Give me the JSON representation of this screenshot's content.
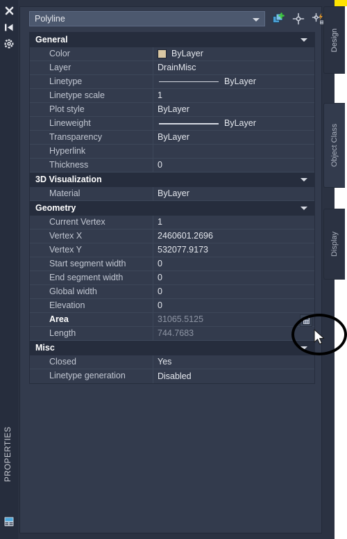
{
  "palette": {
    "title": "PROPERTIES",
    "gutter_icons": [
      {
        "name": "close-icon",
        "label": "Close"
      },
      {
        "name": "auto-hide-icon",
        "label": "Auto-hide"
      },
      {
        "name": "panel-settings-icon",
        "label": "Properties menu"
      }
    ],
    "title_icon": "properties-icon"
  },
  "header": {
    "combo_value": "Polyline",
    "combo_arrow": "chevron-down-icon",
    "tools": [
      {
        "name": "toggle-pickadd-button",
        "icon": "select-objects-plus-icon",
        "label": "Toggle value of PICKADD Sysvar"
      },
      {
        "name": "select-objects-button",
        "icon": "crosshair-icon",
        "label": "Select Objects"
      },
      {
        "name": "quick-select-button",
        "icon": "quick-select-icon",
        "label": "Quick Select"
      }
    ]
  },
  "tabs": [
    {
      "name": "tab-design",
      "label": "Design",
      "active": false
    },
    {
      "name": "tab-object-class",
      "label": "Object Class",
      "active": true
    },
    {
      "name": "tab-display",
      "label": "Display",
      "active": false
    }
  ],
  "sections": [
    {
      "name": "general",
      "title": "General",
      "collapse_icon": "chevron-down-icon",
      "rows": [
        {
          "label": "Color",
          "value": "ByLayer",
          "kind": "color",
          "readonly": false,
          "selected": false
        },
        {
          "label": "Layer",
          "value": "DrainMisc",
          "kind": "text",
          "readonly": false,
          "selected": false
        },
        {
          "label": "Linetype",
          "value": "ByLayer",
          "kind": "linetype",
          "readonly": false,
          "selected": false
        },
        {
          "label": "Linetype scale",
          "value": "1",
          "kind": "text",
          "readonly": false,
          "selected": false
        },
        {
          "label": "Plot style",
          "value": "ByLayer",
          "kind": "text",
          "readonly": false,
          "selected": false
        },
        {
          "label": "Lineweight",
          "value": "ByLayer",
          "kind": "lineweight",
          "readonly": false,
          "selected": false
        },
        {
          "label": "Transparency",
          "value": "ByLayer",
          "kind": "text",
          "readonly": false,
          "selected": false
        },
        {
          "label": "Hyperlink",
          "value": "",
          "kind": "text",
          "readonly": false,
          "selected": false
        },
        {
          "label": "Thickness",
          "value": "0",
          "kind": "text",
          "readonly": false,
          "selected": false
        }
      ]
    },
    {
      "name": "3d-visualization",
      "title": "3D Visualization",
      "collapse_icon": "chevron-down-icon",
      "rows": [
        {
          "label": "Material",
          "value": "ByLayer",
          "kind": "text",
          "readonly": false,
          "selected": false
        }
      ]
    },
    {
      "name": "geometry",
      "title": "Geometry",
      "collapse_icon": "chevron-down-icon",
      "rows": [
        {
          "label": "Current Vertex",
          "value": "1",
          "kind": "text",
          "readonly": false,
          "selected": false
        },
        {
          "label": "Vertex X",
          "value": "2460601.2696",
          "kind": "text",
          "readonly": false,
          "selected": false
        },
        {
          "label": "Vertex Y",
          "value": "532077.9173",
          "kind": "text",
          "readonly": false,
          "selected": false
        },
        {
          "label": "Start segment width",
          "value": "0",
          "kind": "text",
          "readonly": false,
          "selected": false
        },
        {
          "label": "End segment width",
          "value": "0",
          "kind": "text",
          "readonly": false,
          "selected": false
        },
        {
          "label": "Global width",
          "value": "0",
          "kind": "text",
          "readonly": false,
          "selected": false
        },
        {
          "label": "Elevation",
          "value": "0",
          "kind": "text",
          "readonly": false,
          "selected": false
        },
        {
          "label": "Area",
          "value": "31065.5125",
          "kind": "calc",
          "readonly": true,
          "selected": true
        },
        {
          "label": "Length",
          "value": "744.7683",
          "kind": "text",
          "readonly": true,
          "selected": false
        }
      ]
    },
    {
      "name": "misc",
      "title": "Misc",
      "collapse_icon": "chevron-down-icon",
      "rows": [
        {
          "label": "Closed",
          "value": "Yes",
          "kind": "text",
          "readonly": false,
          "selected": false
        },
        {
          "label": "Linetype generation",
          "value": "Disabled",
          "kind": "text",
          "readonly": false,
          "selected": false
        }
      ]
    }
  ],
  "annotation": {
    "name": "highlight-ellipse",
    "shape": "ellipse",
    "color": "#000000",
    "target": "quick-calculator-button"
  },
  "cursor": {
    "name": "mouse-cursor",
    "type": "arrow"
  },
  "colors": {
    "panel_bg": "#2b3242",
    "card_bg": "#333b4d",
    "section_header_bg": "#262d3d",
    "combo_bg": "#4c586e",
    "text": "#e4e7ed",
    "label_text": "#c2c7d2",
    "readonly_text": "#8d94a3",
    "color_swatch": "#d9c7a3",
    "accent_yellow": "#ffe400"
  }
}
